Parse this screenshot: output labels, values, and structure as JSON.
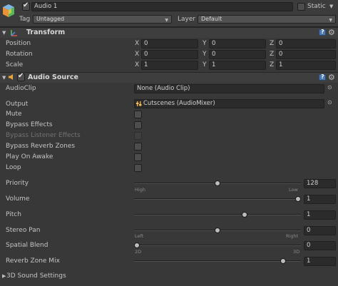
{
  "header": {
    "object_name": "Audio 1",
    "static_label": "Static",
    "tag_label": "Tag",
    "tag_value": "Untagged",
    "layer_label": "Layer",
    "layer_value": "Default",
    "active_checked": true,
    "static_checked": false
  },
  "transform": {
    "title": "Transform",
    "rows": [
      {
        "label": "Position",
        "x": "0",
        "y": "0",
        "z": "0"
      },
      {
        "label": "Rotation",
        "x": "0",
        "y": "0",
        "z": "0"
      },
      {
        "label": "Scale",
        "x": "1",
        "y": "1",
        "z": "1"
      }
    ],
    "axis_x": "X",
    "axis_y": "Y",
    "axis_z": "Z"
  },
  "audio_source": {
    "title": "Audio Source",
    "enabled": true,
    "audio_clip_label": "AudioClip",
    "audio_clip_value": "None (Audio Clip)",
    "output_label": "Output",
    "output_value": "Cutscenes (AudioMixer)",
    "toggles": [
      {
        "label": "Mute",
        "checked": false,
        "disabled": false
      },
      {
        "label": "Bypass Effects",
        "checked": false,
        "disabled": false
      },
      {
        "label": "Bypass Listener Effects",
        "checked": false,
        "disabled": true
      },
      {
        "label": "Bypass Reverb Zones",
        "checked": false,
        "disabled": false
      },
      {
        "label": "Play On Awake",
        "checked": false,
        "disabled": false
      },
      {
        "label": "Loop",
        "checked": false,
        "disabled": false
      }
    ],
    "priority": {
      "label": "Priority",
      "value": "128",
      "left": "High",
      "right": "Low",
      "fraction": 0.5
    },
    "volume": {
      "label": "Volume",
      "value": "1",
      "fraction": 1.0
    },
    "pitch": {
      "label": "Pitch",
      "value": "1",
      "fraction": 0.667
    },
    "stereo_pan": {
      "label": "Stereo Pan",
      "value": "0",
      "left": "Left",
      "right": "Right",
      "fraction": 0.5
    },
    "spatial_blend": {
      "label": "Spatial Blend",
      "value": "0",
      "left": "2D",
      "right": "3D",
      "fraction": 0.0
    },
    "reverb_zone_mix": {
      "label": "Reverb Zone Mix",
      "value": "1",
      "fraction": 0.909
    }
  },
  "sound_settings": {
    "label": "3D Sound Settings"
  },
  "icons": {
    "gameobject": "cube-icon",
    "help": "book-help-icon",
    "settings": "gear-icon",
    "speaker": "speaker-icon",
    "transform": "axis-icon"
  }
}
